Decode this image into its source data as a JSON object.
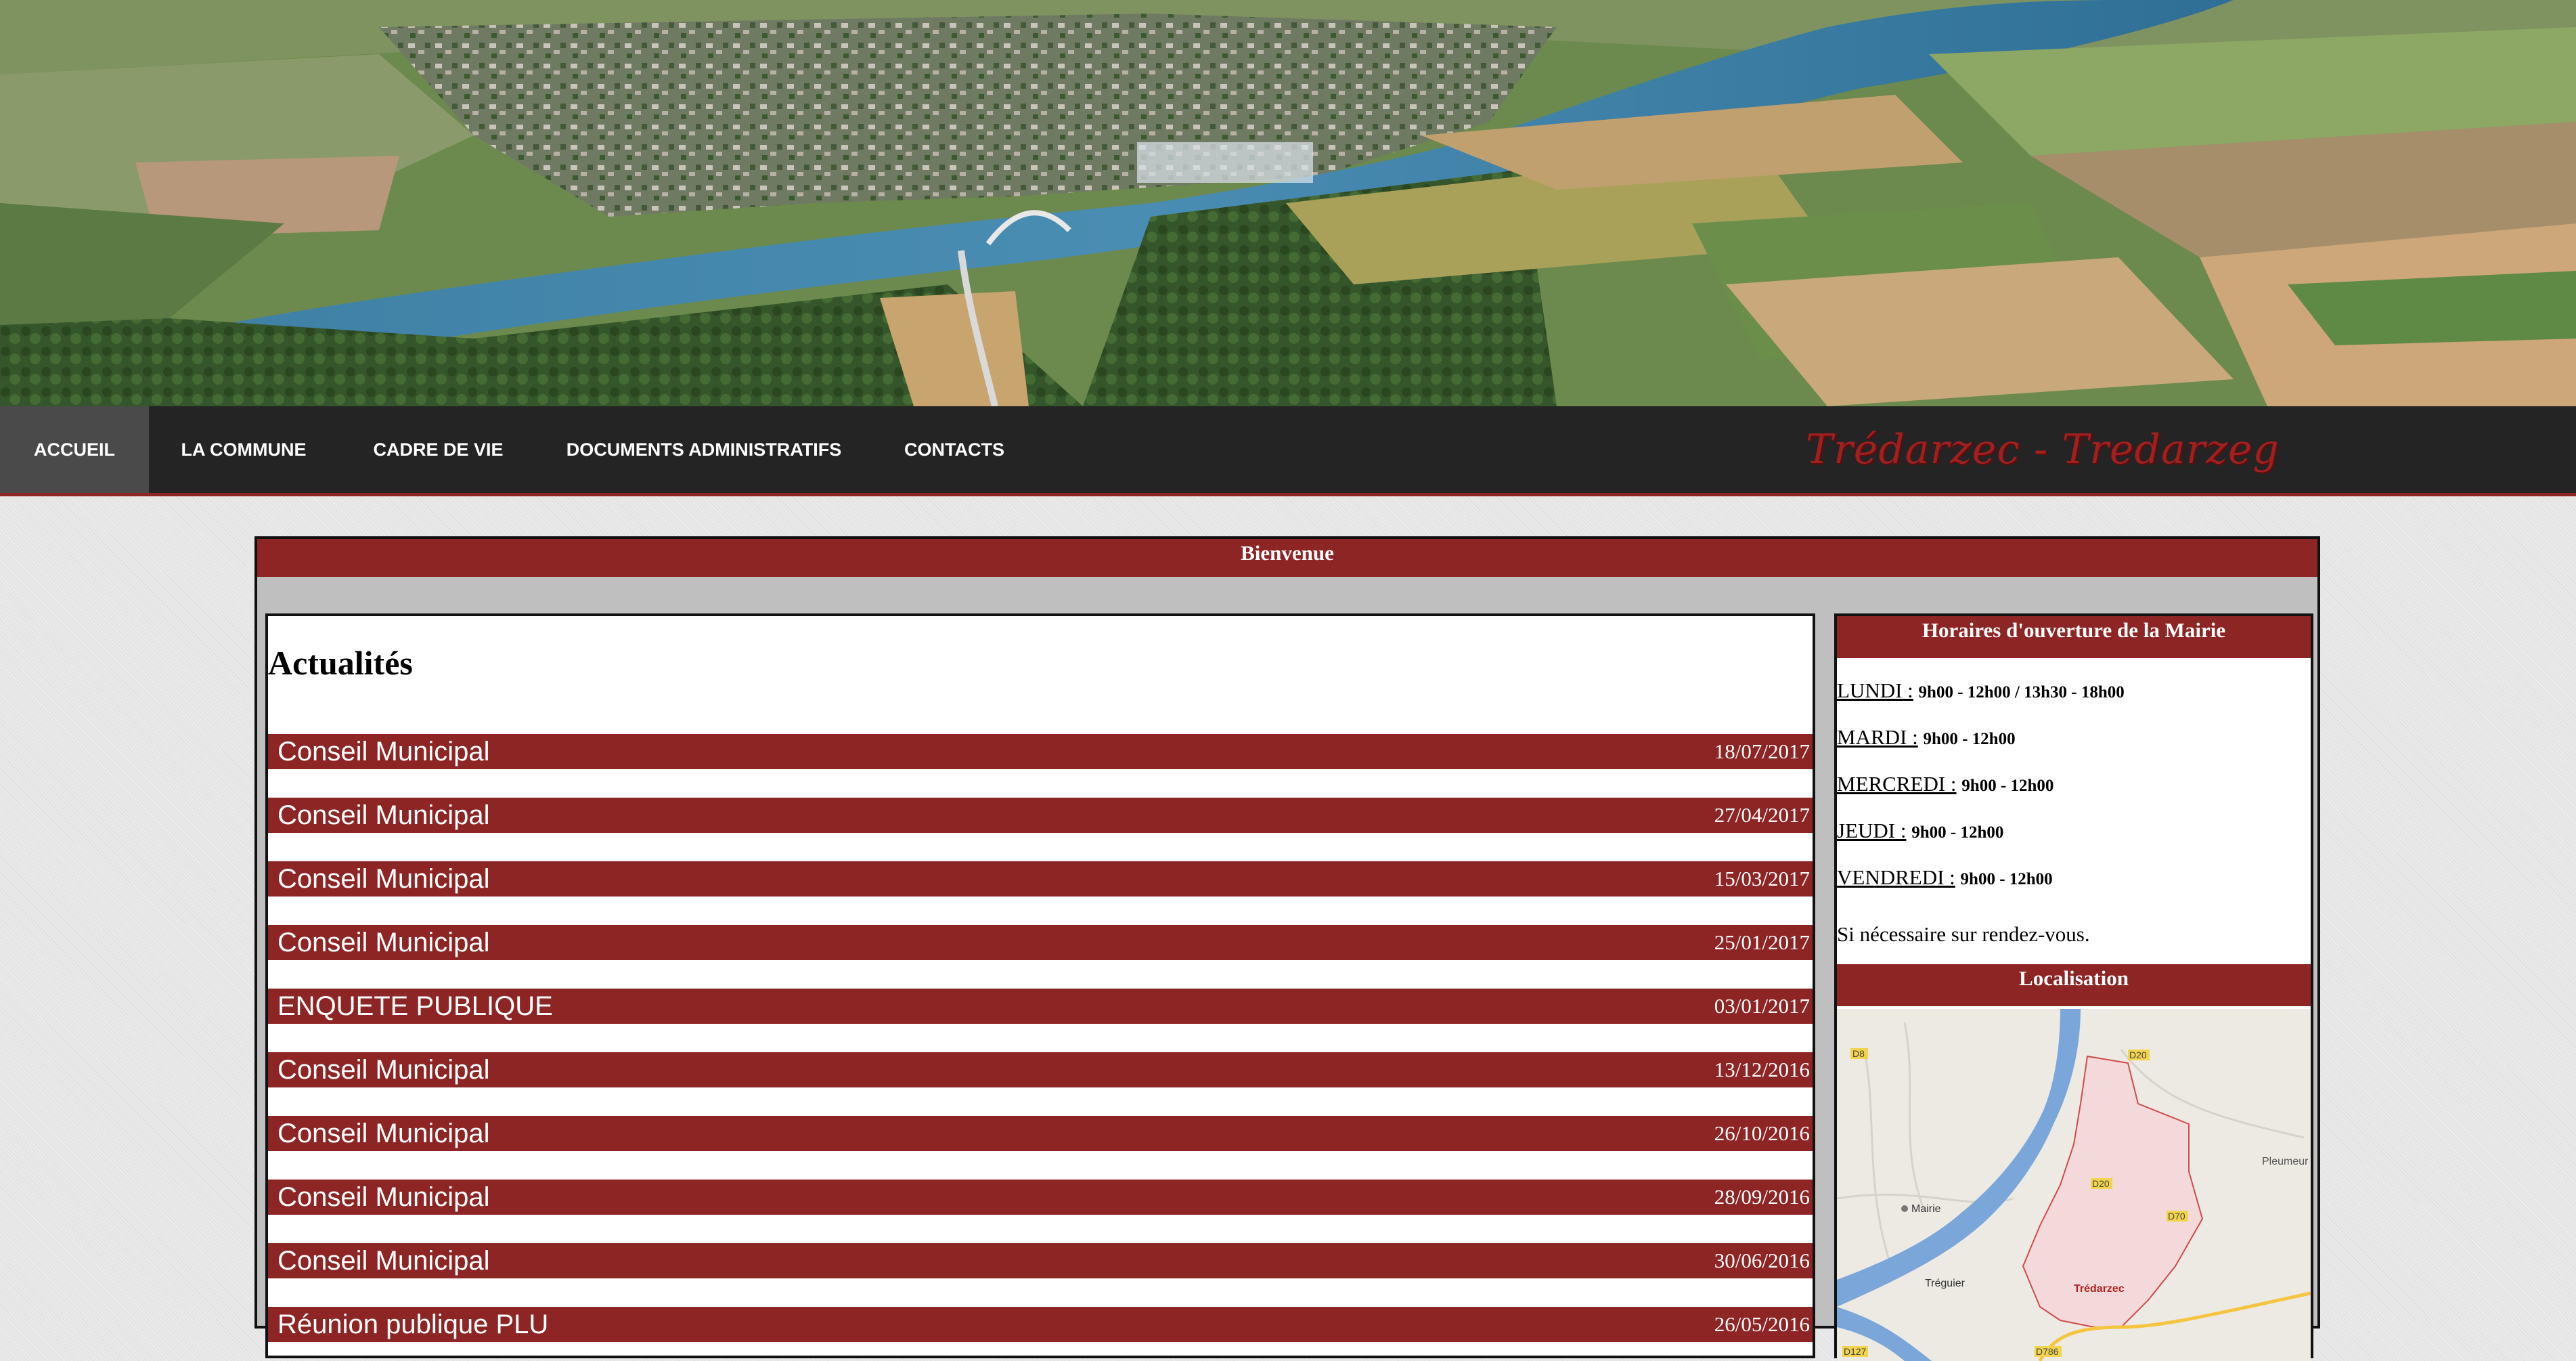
{
  "nav": {
    "items": [
      {
        "label": "ACCUEIL",
        "active": true
      },
      {
        "label": "LA COMMUNE"
      },
      {
        "label": "CADRE DE VIE"
      },
      {
        "label": "DOCUMENTS ADMINISTRATIFS"
      },
      {
        "label": "CONTACTS"
      }
    ],
    "site_title": "Trédarzec - Tredarzeg"
  },
  "panel": {
    "title": "Bienvenue"
  },
  "news": {
    "heading": "Actualités",
    "items": [
      {
        "title": "Conseil Municipal",
        "date": "18/07/2017"
      },
      {
        "title": "Conseil Municipal",
        "date": "27/04/2017"
      },
      {
        "title": "Conseil Municipal",
        "date": "15/03/2017"
      },
      {
        "title": "Conseil Municipal",
        "date": "25/01/2017"
      },
      {
        "title": "ENQUETE PUBLIQUE",
        "date": "03/01/2017"
      },
      {
        "title": "Conseil Municipal",
        "date": "13/12/2016"
      },
      {
        "title": "Conseil Municipal",
        "date": "26/10/2016"
      },
      {
        "title": "Conseil Municipal",
        "date": "28/09/2016"
      },
      {
        "title": "Conseil Municipal",
        "date": "30/06/2016"
      },
      {
        "title": "Réunion publique PLU",
        "date": "26/05/2016"
      }
    ]
  },
  "sidebar": {
    "hours_title": "Horaires d'ouverture de la Mairie",
    "hours": [
      {
        "day": "LUNDI :",
        "value": "9h00 - 12h00 / 13h30 - 18h00"
      },
      {
        "day": "MARDI :",
        "value": "9h00 - 12h00"
      },
      {
        "day": "MERCREDI :",
        "value": "9h00 - 12h00"
      },
      {
        "day": "JEUDI :",
        "value": "9h00 - 12h00"
      },
      {
        "day": "VENDREDI :",
        "value": "9h00 - 12h00"
      }
    ],
    "hours_note": "Si nécessaire sur rendez-vous.",
    "location_title": "Localisation",
    "map_labels": {
      "mairie": "Mairie",
      "treguier": "Tréguier",
      "tredarzec": "Trédarzec",
      "pleumeur": "Pleumeur",
      "road_d8": "D8",
      "road_d20": "D20",
      "road_d70": "D70",
      "road_d786": "D786",
      "road_d127": "D127"
    }
  },
  "colors": {
    "brand_red": "#8e2525",
    "nav_bg": "#242424",
    "nav_active": "#4a4a4a",
    "panel_bg": "#bfbfbf"
  }
}
